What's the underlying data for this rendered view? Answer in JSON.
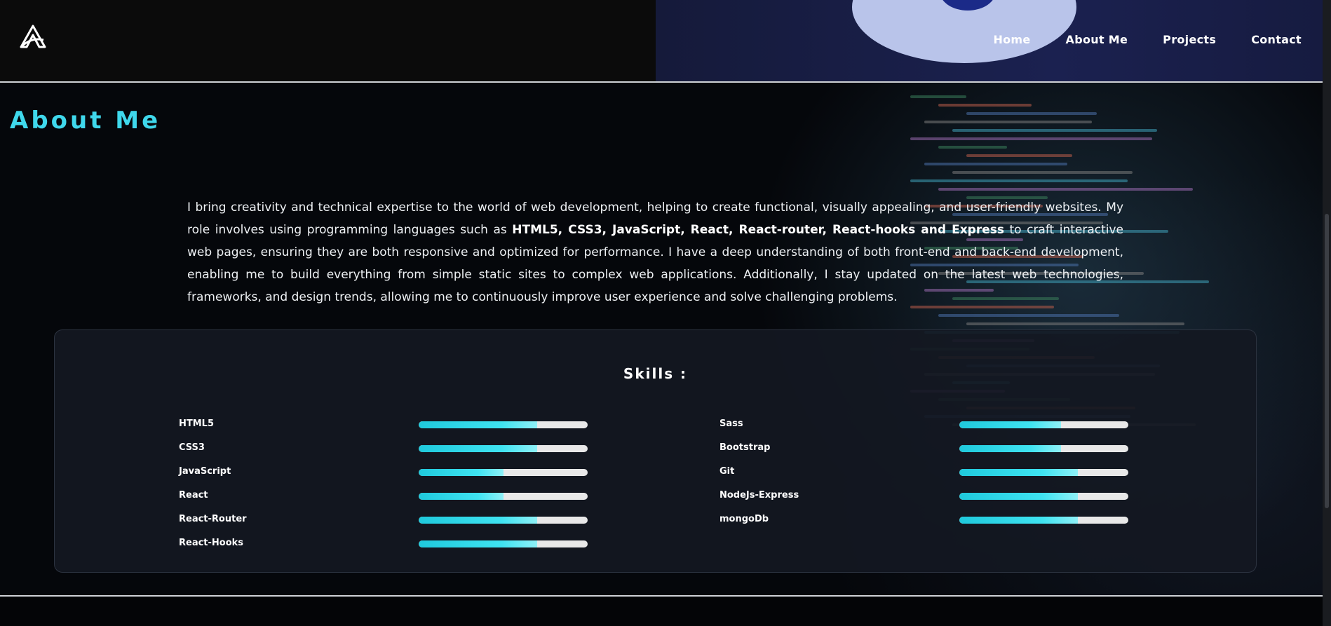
{
  "nav": {
    "items": [
      {
        "label": "Home"
      },
      {
        "label": "About Me"
      },
      {
        "label": "Projects"
      },
      {
        "label": "Contact"
      }
    ]
  },
  "about": {
    "title": "About Me",
    "text_before": "I bring creativity and technical expertise to the world of web development, helping to create functional, visually appealing, and user-friendly websites. My role involves using programming languages such as ",
    "text_bold": "HTML5, CSS3, JavaScript, React, React-router, React-hooks and Express",
    "text_after": " to craft interactive web pages, ensuring they are both responsive and optimized for performance. I have a deep understanding of both front-end and back-end development, enabling me to build everything from simple static sites to complex web applications. Additionally, I stay updated on the latest web technologies, frameworks, and design trends, allowing me to continuously improve user experience and solve challenging problems."
  },
  "skills": {
    "title": "Skills :",
    "accent_color": "#3fd8ec",
    "left": [
      {
        "name": "HTML5",
        "level": 0.7
      },
      {
        "name": "CSS3",
        "level": 0.7
      },
      {
        "name": "JavaScript",
        "level": 0.5
      },
      {
        "name": "React",
        "level": 0.5
      },
      {
        "name": "React-Router",
        "level": 0.7
      },
      {
        "name": "React-Hooks",
        "level": 0.7
      }
    ],
    "right": [
      {
        "name": "Sass",
        "level": 0.6
      },
      {
        "name": "Bootstrap",
        "level": 0.6
      },
      {
        "name": "Git",
        "level": 0.7
      },
      {
        "name": "NodeJs-Express",
        "level": 0.7
      },
      {
        "name": "mongoDb",
        "level": 0.7
      }
    ]
  },
  "icons": {
    "logo": "a-logo-icon"
  }
}
